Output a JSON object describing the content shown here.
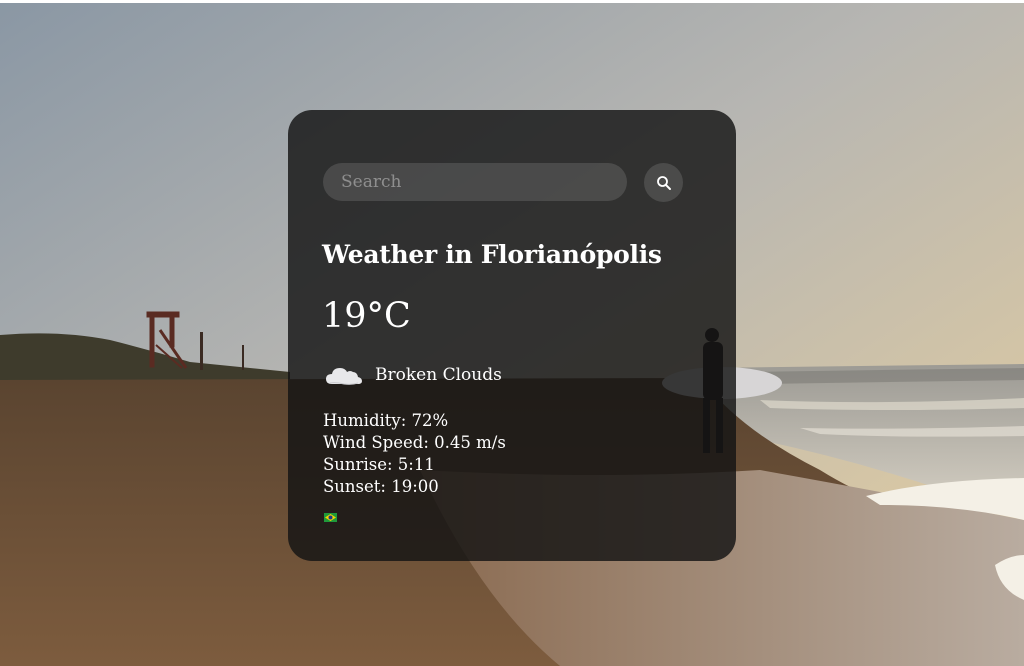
{
  "search": {
    "placeholder": "Search",
    "value": "",
    "button_icon": "search-icon"
  },
  "weather": {
    "title": "Weather in Florianópolis",
    "temperature": "19°C",
    "icon": "cloud-icon",
    "description": "Broken Clouds",
    "humidity": "Humidity: 72%",
    "wind_speed": "Wind Speed: 0.45 m/s",
    "sunrise": "Sunrise: 5:11",
    "sunset": "Sunset: 19:00",
    "country_flag_icon": "brazil-flag-icon"
  },
  "colors": {
    "card_background": "#141414",
    "text": "#ffffff",
    "input_background": "#3a3a3a"
  }
}
